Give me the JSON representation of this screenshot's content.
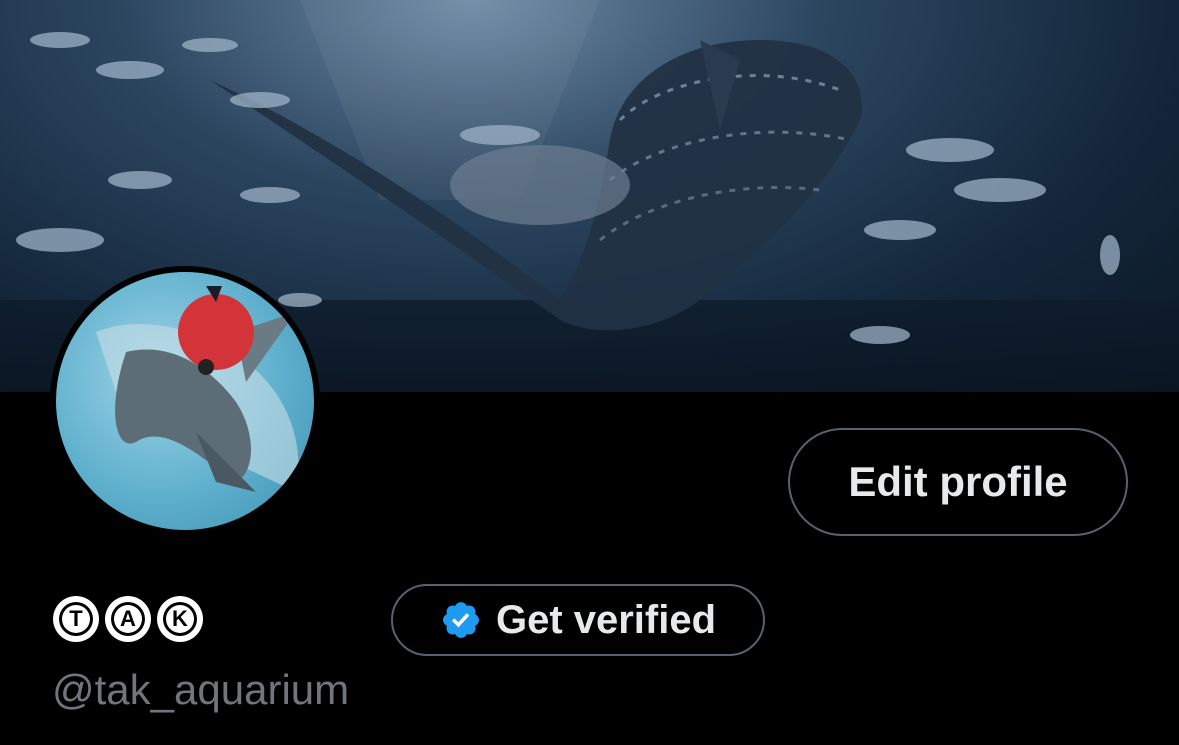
{
  "profile": {
    "display_name_letters": [
      "T",
      "A",
      "K"
    ],
    "handle": "@tak_aquarium",
    "edit_profile_label": "Edit profile",
    "get_verified_label": "Get verified"
  },
  "colors": {
    "background": "#000000",
    "button_border": "#536471",
    "button_text": "#e7e9ea",
    "handle_text": "#71767b",
    "verified_badge": "#1d9bf0"
  },
  "icons": {
    "banner": "whale-shark-aquarium-banner",
    "avatar": "dolphin-with-red-buoy-avatar",
    "verified": "verified-badge-icon"
  }
}
